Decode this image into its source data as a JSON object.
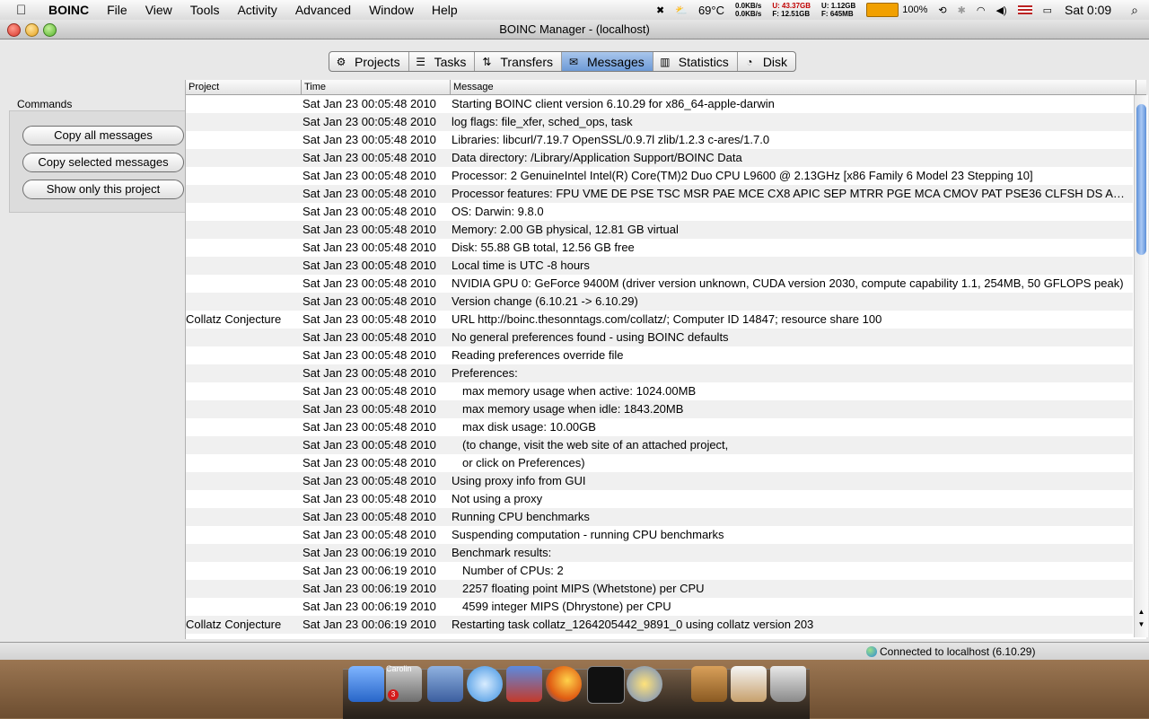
{
  "menubar": {
    "app_name": "BOINC",
    "menus": [
      "File",
      "View",
      "Tools",
      "Activity",
      "Advanced",
      "Window",
      "Help"
    ],
    "temperature": "69°C",
    "net_down": "0.0KB/s",
    "net_up": "0.0KB/s",
    "disk_u": "U: 43.37GB",
    "disk_f": "F: 12.51GB",
    "mem_u": "U: 1.12GB",
    "mem_f": "F: 645MB",
    "battery": "100%",
    "clock": "Sat 0:09"
  },
  "window": {
    "title": "BOINC Manager - (localhost)"
  },
  "tabs": [
    {
      "label": "Projects",
      "icon": "⚙"
    },
    {
      "label": "Tasks",
      "icon": "☰"
    },
    {
      "label": "Transfers",
      "icon": "⇅"
    },
    {
      "label": "Messages",
      "icon": "✉"
    },
    {
      "label": "Statistics",
      "icon": "▥"
    },
    {
      "label": "Disk",
      "icon": "◔"
    }
  ],
  "commands": {
    "title": "Commands",
    "copy_all": "Copy all messages",
    "copy_selected": "Copy selected messages",
    "show_only": "Show only this project"
  },
  "table": {
    "headers": {
      "project": "Project",
      "time": "Time",
      "message": "Message"
    },
    "rows": [
      {
        "p": "",
        "t": "Sat Jan 23 00:05:48 2010",
        "m": "Starting BOINC client version 6.10.29 for x86_64-apple-darwin"
      },
      {
        "p": "",
        "t": "Sat Jan 23 00:05:48 2010",
        "m": "log flags: file_xfer, sched_ops, task"
      },
      {
        "p": "",
        "t": "Sat Jan 23 00:05:48 2010",
        "m": "Libraries: libcurl/7.19.7 OpenSSL/0.9.7l zlib/1.2.3 c-ares/1.7.0"
      },
      {
        "p": "",
        "t": "Sat Jan 23 00:05:48 2010",
        "m": "Data directory: /Library/Application Support/BOINC Data"
      },
      {
        "p": "",
        "t": "Sat Jan 23 00:05:48 2010",
        "m": "Processor: 2 GenuineIntel Intel(R) Core(TM)2 Duo CPU L9600 @ 2.13GHz [x86 Family 6 Model 23 Stepping 10]"
      },
      {
        "p": "",
        "t": "Sat Jan 23 00:05:48 2010",
        "m": "Processor features: FPU VME DE PSE TSC MSR PAE MCE CX8 APIC SEP MTRR PGE MCA CMOV PAT PSE36 CLFSH DS ACPI MMX FXS.."
      },
      {
        "p": "",
        "t": "Sat Jan 23 00:05:48 2010",
        "m": "OS: Darwin: 9.8.0"
      },
      {
        "p": "",
        "t": "Sat Jan 23 00:05:48 2010",
        "m": "Memory: 2.00 GB physical, 12.81 GB virtual"
      },
      {
        "p": "",
        "t": "Sat Jan 23 00:05:48 2010",
        "m": "Disk: 55.88 GB total, 12.56 GB free"
      },
      {
        "p": "",
        "t": "Sat Jan 23 00:05:48 2010",
        "m": "Local time is UTC -8 hours"
      },
      {
        "p": "",
        "t": "Sat Jan 23 00:05:48 2010",
        "m": "NVIDIA GPU 0: GeForce 9400M (driver version unknown, CUDA version 2030, compute capability 1.1, 254MB, 50 GFLOPS peak)"
      },
      {
        "p": "",
        "t": "Sat Jan 23 00:05:48 2010",
        "m": "Version change (6.10.21 -> 6.10.29)"
      },
      {
        "p": "Collatz Conjecture",
        "t": "Sat Jan 23 00:05:48 2010",
        "m": "URL http://boinc.thesonntags.com/collatz/; Computer ID 14847; resource share 100"
      },
      {
        "p": "",
        "t": "Sat Jan 23 00:05:48 2010",
        "m": "No general preferences found - using BOINC defaults"
      },
      {
        "p": "",
        "t": "Sat Jan 23 00:05:48 2010",
        "m": "Reading preferences override file"
      },
      {
        "p": "",
        "t": "Sat Jan 23 00:05:48 2010",
        "m": "Preferences:"
      },
      {
        "p": "",
        "t": "Sat Jan 23 00:05:48 2010",
        "m": "max memory usage when active: 1024.00MB",
        "indent": true
      },
      {
        "p": "",
        "t": "Sat Jan 23 00:05:48 2010",
        "m": "max memory usage when idle: 1843.20MB",
        "indent": true
      },
      {
        "p": "",
        "t": "Sat Jan 23 00:05:48 2010",
        "m": "max disk usage: 10.00GB",
        "indent": true
      },
      {
        "p": "",
        "t": "Sat Jan 23 00:05:48 2010",
        "m": "(to change, visit the web site of an attached project,",
        "indent": true
      },
      {
        "p": "",
        "t": "Sat Jan 23 00:05:48 2010",
        "m": "or click on Preferences)",
        "indent": true
      },
      {
        "p": "",
        "t": "Sat Jan 23 00:05:48 2010",
        "m": "Using proxy info from GUI"
      },
      {
        "p": "",
        "t": "Sat Jan 23 00:05:48 2010",
        "m": "Not using a proxy"
      },
      {
        "p": "",
        "t": "Sat Jan 23 00:05:48 2010",
        "m": "Running CPU benchmarks"
      },
      {
        "p": "",
        "t": "Sat Jan 23 00:05:48 2010",
        "m": "Suspending computation - running CPU benchmarks"
      },
      {
        "p": "",
        "t": "Sat Jan 23 00:06:19 2010",
        "m": "Benchmark results:"
      },
      {
        "p": "",
        "t": "Sat Jan 23 00:06:19 2010",
        "m": "Number of CPUs: 2",
        "indent": true
      },
      {
        "p": "",
        "t": "Sat Jan 23 00:06:19 2010",
        "m": "2257 floating point MIPS (Whetstone) per CPU",
        "indent": true
      },
      {
        "p": "",
        "t": "Sat Jan 23 00:06:19 2010",
        "m": "4599 integer MIPS (Dhrystone) per CPU",
        "indent": true
      },
      {
        "p": "Collatz Conjecture",
        "t": "Sat Jan 23 00:06:19 2010",
        "m": "Restarting task collatz_1264205442_9891_0 using collatz version 203"
      }
    ]
  },
  "status": {
    "text": "Connected to localhost (6.10.29)"
  },
  "dock": {
    "badge_count": "3",
    "user_label": "Carolin"
  }
}
